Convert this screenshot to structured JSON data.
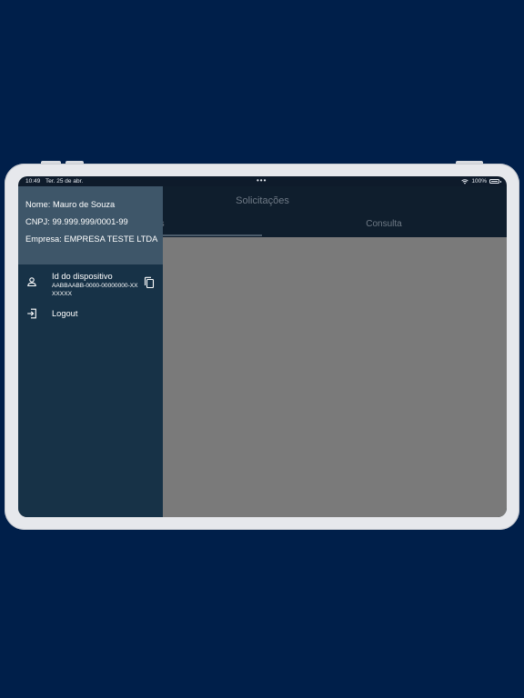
{
  "status_bar": {
    "time": "10:49",
    "date": "Ter. 25 de abr.",
    "dots": "•••",
    "battery_text": "100%",
    "icons": [
      "wifi-icon",
      "battery-icon"
    ]
  },
  "header": {
    "title": "Solicitações",
    "tabs": [
      {
        "label": "Solicitações"
      },
      {
        "label": "Consulta"
      }
    ]
  },
  "drawer": {
    "nome": "Nome: Mauro de Souza",
    "cnpj": "CNPJ: 99.999.999/0001-99",
    "empresa": "Empresa: EMPRESA TESTE LTDA",
    "items": [
      {
        "title": "Id do dispositivo",
        "subtitle": "AABBAABB-0000-00000000-XXXXXXX",
        "icon": "person-icon",
        "action_icon": "copy-icon"
      },
      {
        "title": "Logout",
        "icon": "logout-icon"
      }
    ]
  },
  "colors": {
    "background": "#001f4a",
    "drawer": "#173247",
    "drawer_header": "#3e5669",
    "overlay": "#7a7a7a"
  }
}
